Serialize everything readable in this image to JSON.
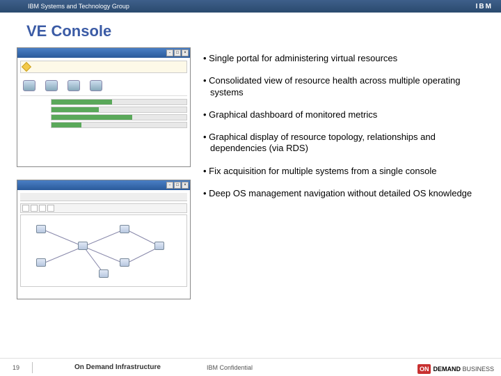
{
  "header": {
    "group_label": "IBM Systems and Technology Group",
    "logo_text": "IBM"
  },
  "slide": {
    "title": "VE Console",
    "bullets": [
      "Single portal for administering virtual resources",
      "Consolidated view of resource health across multiple operating systems",
      "Graphical dashboard of monitored metrics",
      "Graphical display of resource topology, relationships and dependencies (via RDS)",
      "Fix acquisition for multiple systems from a single console",
      "Deep OS management navigation without detailed OS knowledge"
    ]
  },
  "footer": {
    "page_number": "19",
    "brand": "On Demand Infrastructure",
    "confidential": "IBM Confidential",
    "badge_on": "ON",
    "badge_demand": "DEMAND",
    "badge_business": "BUSINESS"
  }
}
